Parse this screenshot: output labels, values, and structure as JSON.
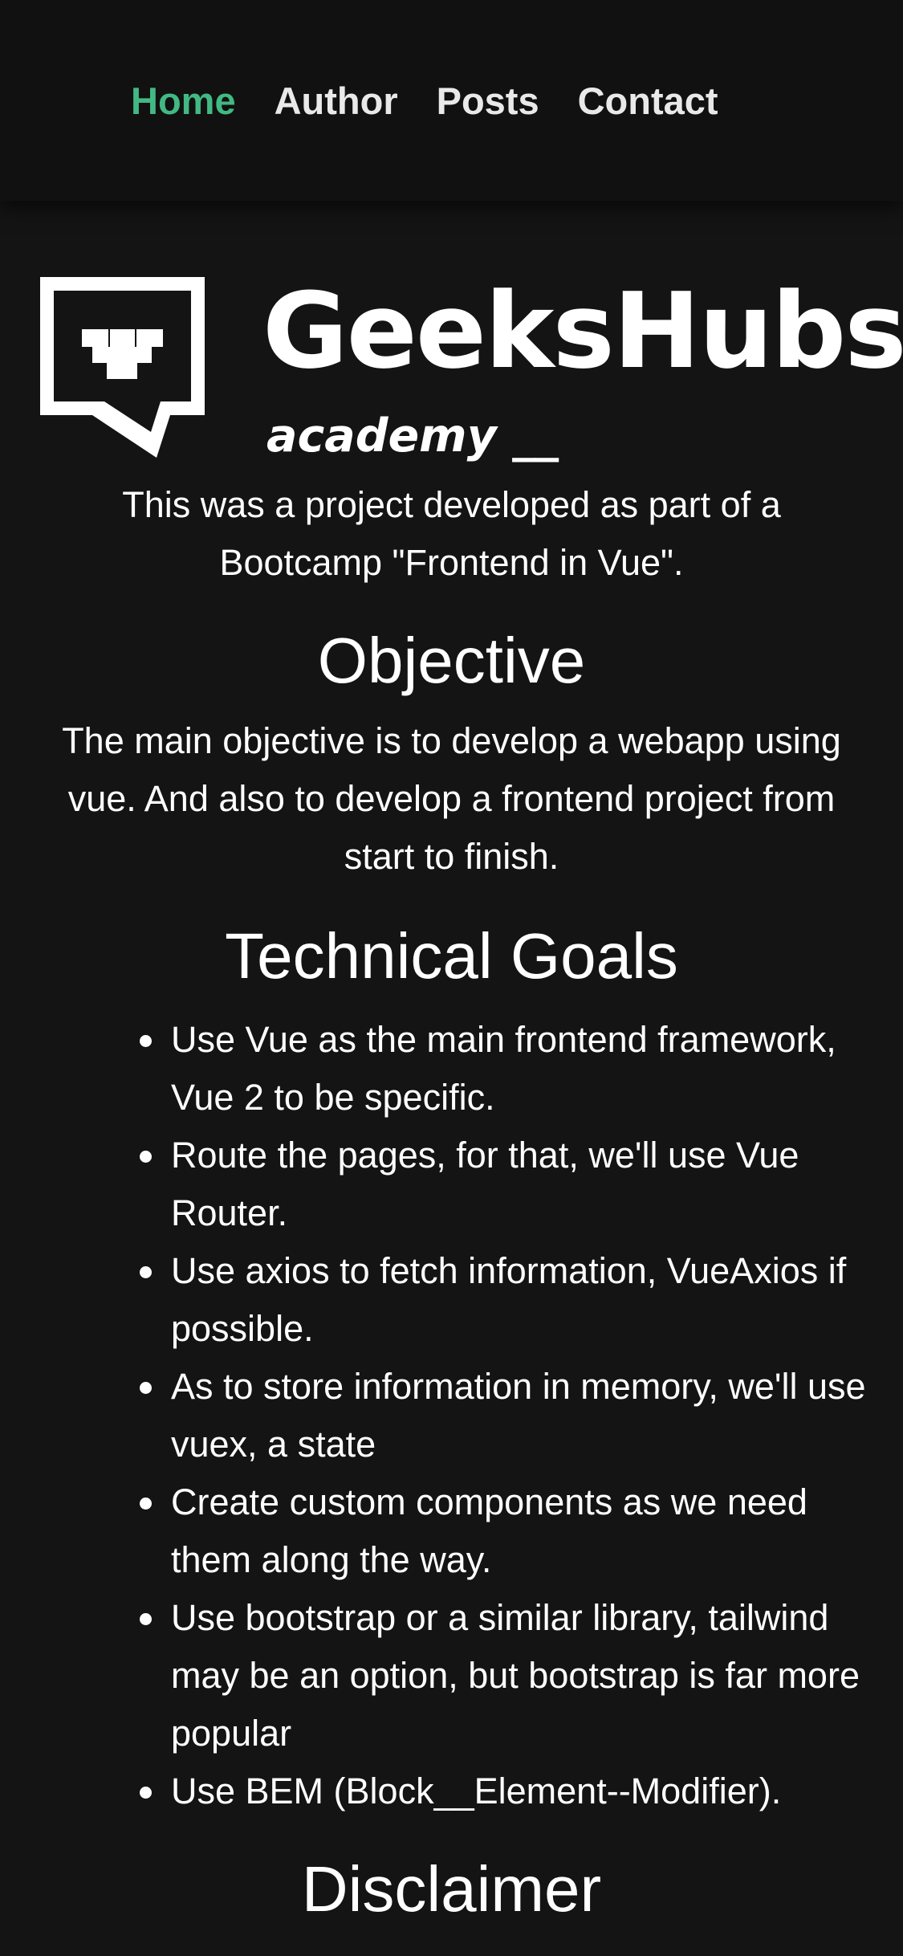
{
  "nav": {
    "items": [
      {
        "label": "Home",
        "active": true
      },
      {
        "label": "Author",
        "active": false
      },
      {
        "label": "Posts",
        "active": false
      },
      {
        "label": "Contact",
        "active": false
      }
    ],
    "active_color": "#42b983"
  },
  "logo": {
    "title": "GeeksHubs",
    "subtitle": "academy __"
  },
  "intro": "This was a project developed as part of a Bootcamp \"Frontend in Vue\".",
  "objective": {
    "heading": "Objective",
    "text": "The main objective is to develop a webapp using vue. And also to develop a frontend project from start to finish."
  },
  "technical_goals": {
    "heading": "Technical Goals",
    "items": [
      "Use Vue as the main frontend framework, Vue 2 to be specific.",
      "Route the pages, for that, we'll use Vue Router.",
      "Use axios to fetch information, VueAxios if possible.",
      "As to store information in memory, we'll use vuex, a state",
      "Create custom components as we need them along the way.",
      "Use bootstrap or a similar library, tailwind may be an option, but bootstrap is far more popular",
      "Use BEM (Block__Element--Modifier)."
    ]
  },
  "disclaimer": {
    "heading": "Disclaimer"
  },
  "colors": {
    "background": "#141414",
    "navbar": "#111111",
    "text": "#ffffff"
  }
}
